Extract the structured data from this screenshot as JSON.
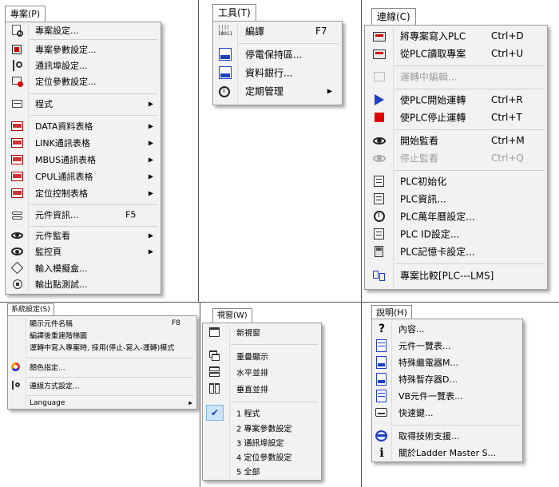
{
  "menus": {
    "project": {
      "tab": "專案(P)",
      "items": [
        {
          "label": "專案設定...",
          "icon": "project-settings-icon"
        },
        {
          "label": "專案參數設定...",
          "icon": "parameter-settings-icon"
        },
        {
          "label": "通訊埠設定...",
          "icon": "comm-port-icon"
        },
        {
          "label": "定位參數設定...",
          "icon": "positioning-icon"
        },
        {
          "label": "程式",
          "icon": "program-icon",
          "submenu": true
        },
        {
          "label": "DATA資料表格",
          "icon": "data-table-icon",
          "submenu": true
        },
        {
          "label": "LINK通訊表格",
          "icon": "link-table-icon",
          "submenu": true
        },
        {
          "label": "MBUS通訊表格",
          "icon": "mbus-table-icon",
          "submenu": true
        },
        {
          "label": "CPUL通訊表格",
          "icon": "cpul-table-icon",
          "submenu": true
        },
        {
          "label": "定位控制表格",
          "icon": "position-table-icon",
          "submenu": true
        },
        {
          "label": "元件資訊...",
          "icon": "element-info-icon",
          "shortcut": "F5"
        },
        {
          "label": "元件監看",
          "icon": "eye-icon",
          "submenu": true
        },
        {
          "label": "監控頁",
          "icon": "monitor-page-icon",
          "submenu": true
        },
        {
          "label": "輸入模擬盒...",
          "icon": "input-sim-icon"
        },
        {
          "label": "輸出點測試...",
          "icon": "output-test-icon"
        }
      ]
    },
    "tools": {
      "tab": "工具(T)",
      "items": [
        {
          "label": "編譯",
          "icon": "compile-icon",
          "shortcut": "F7"
        },
        {
          "label": "停電保持區...",
          "icon": "retentive-icon"
        },
        {
          "label": "資料銀行...",
          "icon": "databank-icon"
        },
        {
          "label": "定期管理",
          "icon": "alarm-clock-icon",
          "submenu": true
        }
      ]
    },
    "connect": {
      "tab": "連線(C)",
      "items": [
        {
          "label": "將專案寫入PLC",
          "icon": "write-plc-icon",
          "shortcut": "Ctrl+D"
        },
        {
          "label": "從PLC讀取專案",
          "icon": "read-plc-icon",
          "shortcut": "Ctrl+U"
        },
        {
          "label": "運轉中編輯...",
          "icon": "run-edit-icon",
          "disabled": true
        },
        {
          "label": "使PLC開始運轉",
          "icon": "play-icon",
          "shortcut": "Ctrl+R"
        },
        {
          "label": "使PLC停止運轉",
          "icon": "stop-icon",
          "shortcut": "Ctrl+T"
        },
        {
          "label": "開始監看",
          "icon": "eye-icon",
          "shortcut": "Ctrl+M"
        },
        {
          "label": "停止監看",
          "icon": "eye-disabled-icon",
          "shortcut": "Ctrl+Q",
          "disabled": true
        },
        {
          "label": "PLC初始化",
          "icon": "plc-init-icon"
        },
        {
          "label": "PLC資訊...",
          "icon": "plc-info-icon"
        },
        {
          "label": "PLC萬年曆設定...",
          "icon": "clock-icon"
        },
        {
          "label": "PLC ID設定...",
          "icon": "plc-id-icon"
        },
        {
          "label": "PLC記憶卡設定...",
          "icon": "memory-card-icon"
        },
        {
          "label": "專案比較[PLC---LMS]",
          "icon": "compare-icon"
        }
      ]
    },
    "system": {
      "tab": "系統設定(S)",
      "items": [
        {
          "label": "顯示元件名稱",
          "shortcut": "F8"
        },
        {
          "label": "編譯後重建階梯圖"
        },
        {
          "label": "運轉中寫入專案時, 採用(停止-寫入-運轉)模式"
        },
        {
          "label": "顏色指定...",
          "icon": "color-icon"
        },
        {
          "label": "連線方式設定...",
          "icon": "connection-icon"
        },
        {
          "label": "Language",
          "submenu": true
        }
      ]
    },
    "window": {
      "tab": "視窗(W)",
      "items": [
        {
          "label": "新視窗",
          "icon": "new-window-icon"
        },
        {
          "label": "重疊顯示",
          "icon": "cascade-icon"
        },
        {
          "label": "水平並排",
          "icon": "tile-horizontal-icon"
        },
        {
          "label": "垂直並排",
          "icon": "tile-vertical-icon"
        },
        {
          "label": "1 程式",
          "icon": "check-icon",
          "checked": true
        },
        {
          "label": "2 專案參數設定"
        },
        {
          "label": "3 通訊埠設定"
        },
        {
          "label": "4 定位參數設定"
        },
        {
          "label": "5 全部"
        }
      ]
    },
    "help": {
      "tab": "說明(H)",
      "items": [
        {
          "label": "內容...",
          "icon": "question-icon"
        },
        {
          "label": "元件一覽表...",
          "icon": "element-list-icon"
        },
        {
          "label": "特殊繼電器M...",
          "icon": "special-relay-icon"
        },
        {
          "label": "特殊暫存器D...",
          "icon": "special-register-icon"
        },
        {
          "label": "VB元件一覽表...",
          "icon": "vb-list-icon"
        },
        {
          "label": "快速鍵...",
          "icon": "hotkey-icon"
        },
        {
          "label": "取得技術支援...",
          "icon": "support-icon"
        },
        {
          "label": "關於Ladder Master S...",
          "icon": "info-icon"
        }
      ]
    }
  },
  "colors": {
    "accent_blue": "#1f3fbf",
    "stop_red": "#e00000",
    "highlight": "#cce4f7"
  }
}
